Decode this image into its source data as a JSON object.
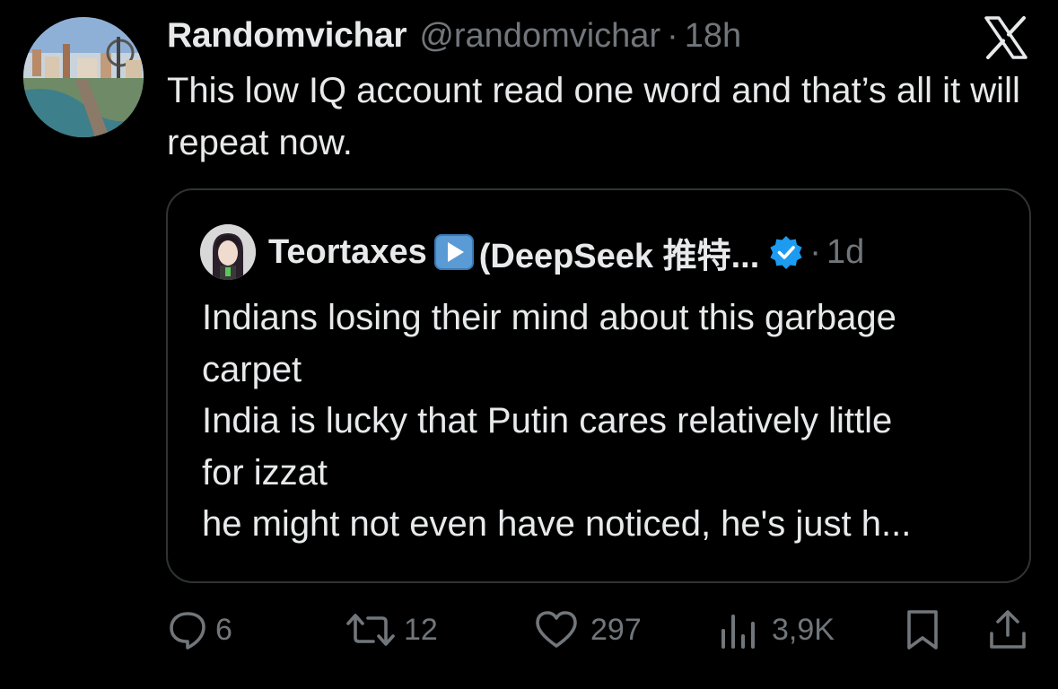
{
  "tweet": {
    "author_name": "Randomvichar",
    "author_handle": "@randomvichar",
    "separator": "·",
    "time": "18h",
    "text": "This low IQ account read one word and that’s all it will repeat now."
  },
  "quoted_tweet": {
    "author_name": "Teortaxes",
    "author_name_suffix": "(DeepSeek 推特...",
    "verified": true,
    "separator": "·",
    "time": "1d",
    "lines": [
      "Indians losing their mind about this garbage",
      "carpet",
      "India is lucky that Putin cares relatively little",
      "for izzat",
      "he might not even have noticed, he's just h..."
    ]
  },
  "actions": {
    "reply_count": "6",
    "retweet_count": "12",
    "like_count": "297",
    "views_count": "3,9K"
  },
  "icons": {
    "platform_logo": "x-logo-icon",
    "reply": "reply-bubble-icon",
    "retweet": "retweet-arrows-icon",
    "like": "heart-icon",
    "views": "views-bars-icon",
    "bookmark": "bookmark-icon",
    "share": "share-upload-icon",
    "verified": "verified-badge-icon",
    "play": "play-button-emoji-icon"
  },
  "colors": {
    "background": "#000000",
    "text_primary": "#e7e9ea",
    "text_secondary": "#71767b",
    "border": "#2f3336",
    "verified_blue": "#1d9bf0"
  }
}
